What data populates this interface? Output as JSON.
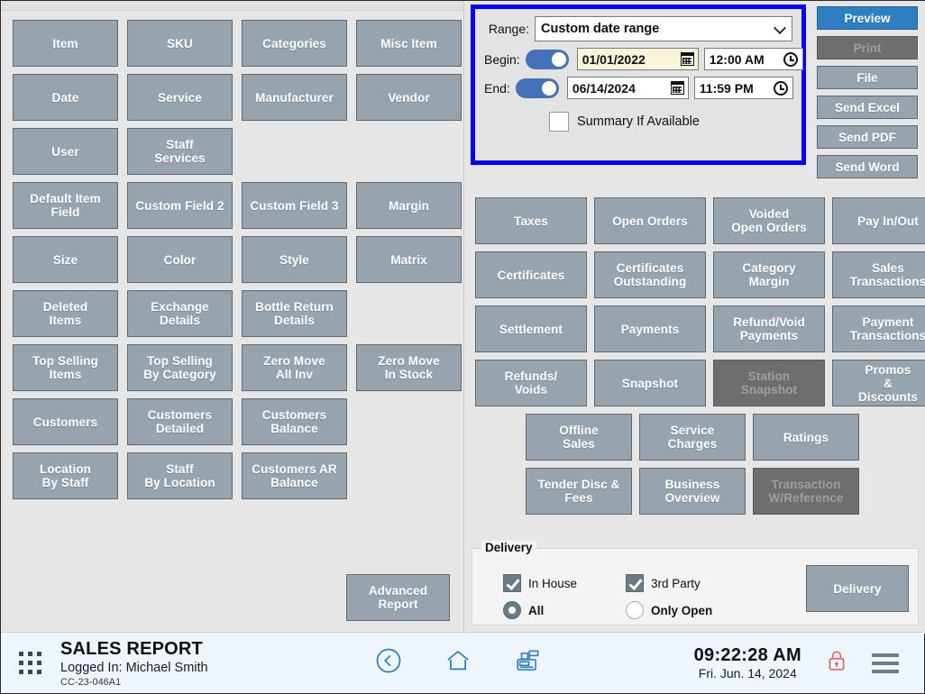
{
  "left_reports": {
    "rows": [
      [
        "Item",
        "SKU",
        "Categories",
        "Misc Item"
      ],
      [
        "Date",
        "Service",
        "Manufacturer",
        "Vendor"
      ],
      [
        "User",
        "Staff\nServices",
        "",
        ""
      ],
      [
        "Default Item\nField",
        "Custom Field 2",
        "Custom Field 3",
        "Margin"
      ],
      [
        "Size",
        "Color",
        "Style",
        "Matrix"
      ],
      [
        "Deleted\nItems",
        "Exchange\nDetails",
        "Bottle Return\nDetails",
        ""
      ],
      [
        "Top Selling\nItems",
        "Top Selling\nBy Category",
        "Zero Move\nAll Inv",
        "Zero Move\nIn Stock"
      ],
      [
        "Customers",
        "Customers\nDetailed",
        "Customers\nBalance",
        ""
      ],
      [
        "Location\nBy Staff",
        "Staff\nBy Location",
        "Customers AR\nBalance",
        ""
      ]
    ],
    "advanced_report": "Advanced\nReport"
  },
  "daterange": {
    "range_label": "Range:",
    "range_value": "Custom date range",
    "begin_label": "Begin:",
    "begin_date": "01/01/2022",
    "begin_time": "12:00 AM",
    "end_label": "End:",
    "end_date": "06/14/2024",
    "end_time": "11:59 PM",
    "summary_label": "Summary If Available",
    "highlight_color": "#0000ff"
  },
  "actions": {
    "buttons": [
      {
        "label": "Preview",
        "state": "primary"
      },
      {
        "label": "Print",
        "state": "disabled"
      },
      {
        "label": "File",
        "state": "normal"
      },
      {
        "label": "Send Excel",
        "state": "normal"
      },
      {
        "label": "Send PDF",
        "state": "normal"
      },
      {
        "label": "Send Word",
        "state": "normal"
      }
    ],
    "primary_color": "#2d7fc1"
  },
  "right_reports": {
    "rows": [
      [
        {
          "label": "Taxes",
          "state": "normal"
        },
        {
          "label": "Open Orders",
          "state": "normal"
        },
        {
          "label": "Voided\nOpen Orders",
          "state": "normal"
        },
        {
          "label": "Pay In/Out",
          "state": "normal"
        }
      ],
      [
        {
          "label": "Certificates",
          "state": "normal"
        },
        {
          "label": "Certificates\nOutstanding",
          "state": "normal"
        },
        {
          "label": "Category\nMargin",
          "state": "normal"
        },
        {
          "label": "Sales\nTransactions",
          "state": "normal"
        }
      ],
      [
        {
          "label": "Settlement",
          "state": "normal"
        },
        {
          "label": "Payments",
          "state": "normal"
        },
        {
          "label": "Refund/Void\nPayments",
          "state": "normal"
        },
        {
          "label": "Payment\nTransactions",
          "state": "normal"
        }
      ],
      [
        {
          "label": "Refunds/\nVoids",
          "state": "normal"
        },
        {
          "label": "Snapshot",
          "state": "normal"
        },
        {
          "label": "Station\nSnapshot",
          "state": "disabled"
        },
        {
          "label": "Promos\n&\nDiscounts",
          "state": "normal"
        }
      ]
    ],
    "centered_rows": [
      [
        {
          "label": "Offline\nSales",
          "state": "normal"
        },
        {
          "label": "Service\nCharges",
          "state": "normal"
        },
        {
          "label": "Ratings",
          "state": "normal"
        }
      ],
      [
        {
          "label": "Tender Disc &\nFees",
          "state": "normal"
        },
        {
          "label": "Business\nOverview",
          "state": "normal"
        },
        {
          "label": "Transaction\nW/Reference",
          "state": "disabled"
        }
      ]
    ]
  },
  "delivery": {
    "legend": "Delivery",
    "in_house": "In House",
    "third_party": "3rd Party",
    "all": "All",
    "only_open": "Only Open",
    "button": "Delivery"
  },
  "statusbar": {
    "title": "SALES REPORT",
    "logged_in": "Logged In:  Michael Smith",
    "code": "CC-23-046A1",
    "time": "09:22:28 AM",
    "date": "Fri. Jun. 14, 2024",
    "accent_color": "#2f7fc0",
    "lock_color": "#e06070"
  }
}
